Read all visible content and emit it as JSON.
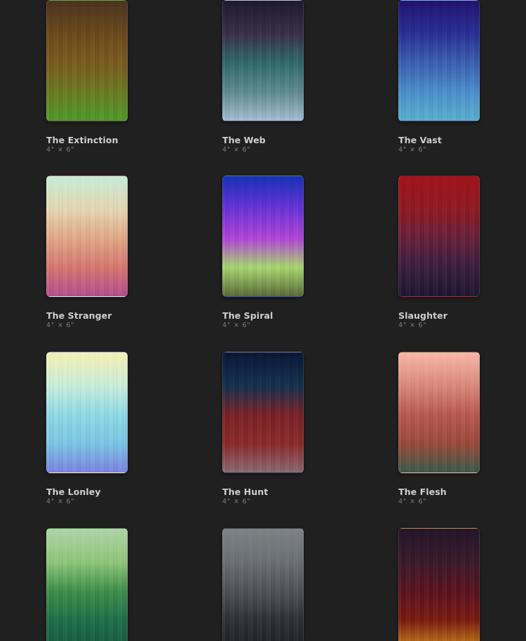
{
  "cards": [
    {
      "title": "The Extinction",
      "size": "4\" × 6\"",
      "colors": [
        "#4a3320",
        "#6b4a1c",
        "#7a5a1e",
        "#6a7a22",
        "#4f9a2a"
      ]
    },
    {
      "title": "The Web",
      "size": "4\" × 6\"",
      "colors": [
        "#1f1a2c",
        "#3a2f4a",
        "#2f6a6a",
        "#5f8a90",
        "#a6bed3"
      ]
    },
    {
      "title": "The Vast",
      "size": "4\" × 6\"",
      "colors": [
        "#21146e",
        "#2a2f95",
        "#3a5fb0",
        "#4a8fcc",
        "#5ab0cf"
      ]
    },
    {
      "title": "The Stranger",
      "size": "4\" × 6\"",
      "colors": [
        "#c7ecd9",
        "#e6d7b2",
        "#e2a888",
        "#d8776f",
        "#b54e8e"
      ]
    },
    {
      "title": "The Spiral",
      "size": "4\" × 6\"",
      "colors": [
        "#1532b8",
        "#6b33d6",
        "#b245d9",
        "#a8d76e",
        "#5a6a3a"
      ]
    },
    {
      "title": "Slaughter",
      "size": "4\" × 6\"",
      "colors": [
        "#a0141c",
        "#8e1a22",
        "#66203a",
        "#3a1d40",
        "#1e1630"
      ]
    },
    {
      "title": "The Lonley",
      "size": "4\" × 6\"",
      "colors": [
        "#f6f0b3",
        "#c8eedc",
        "#90dbe6",
        "#7bc6e6",
        "#7c84e4"
      ]
    },
    {
      "title": "The Hunt",
      "size": "4\" × 6\"",
      "colors": [
        "#0b1838",
        "#15304e",
        "#7a2126",
        "#8a2a2a",
        "#8a6a72"
      ]
    },
    {
      "title": "The Flesh",
      "size": "4\" × 6\"",
      "colors": [
        "#fbb7a8",
        "#d98a7a",
        "#b9584f",
        "#9a4a3a",
        "#3a5a4a"
      ]
    },
    {
      "title": "",
      "size": "",
      "colors": [
        "#b2d4a8",
        "#8ec67a",
        "#3f8f4a",
        "#1f6e4a",
        "#155a3a"
      ]
    },
    {
      "title": "",
      "size": "",
      "colors": [
        "#7d8386",
        "#6a6f74",
        "#4e5258",
        "#2f3036",
        "#1f2026"
      ]
    },
    {
      "title": "",
      "size": "",
      "colors": [
        "#231629",
        "#3a1a2a",
        "#5a1220",
        "#7a1a10",
        "#c8801a"
      ]
    }
  ]
}
